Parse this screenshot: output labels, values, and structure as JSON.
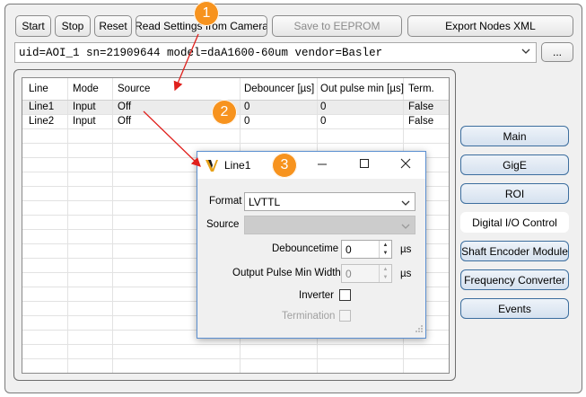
{
  "toolbar": {
    "start": "Start",
    "stop": "Stop",
    "reset": "Reset",
    "read_settings": "Read Settings from Camera",
    "save_eeprom": "Save to EEPROM",
    "export_nodes": "Export Nodes XML"
  },
  "device_select": {
    "value": "uid=AOI_1 sn=21909644 model=daA1600-60um vendor=Basler",
    "browse_label": "..."
  },
  "grid": {
    "columns": [
      "Line",
      "Mode",
      "Source",
      "Debouncer [µs]",
      "Out pulse min [µs]",
      "Term."
    ],
    "rows": [
      [
        "Line1",
        "Input",
        "Off",
        "0",
        "0",
        "False"
      ],
      [
        "Line2",
        "Input",
        "Off",
        "0",
        "0",
        "False"
      ]
    ]
  },
  "side_nav": [
    {
      "label": "Main"
    },
    {
      "label": "GigE"
    },
    {
      "label": "ROI"
    },
    {
      "label": "Digital I/O Control"
    },
    {
      "label": "Shaft Encoder Module"
    },
    {
      "label": "Frequency Converter"
    },
    {
      "label": "Events"
    }
  ],
  "dialog": {
    "title": "Line1",
    "format_label": "Format",
    "format_value": "LVTTL",
    "source_label": "Source",
    "source_value": "",
    "debounce_label": "Debouncetime",
    "debounce_value": "0",
    "debounce_unit": "µs",
    "pulse_label": "Output Pulse Min Width",
    "pulse_value": "0",
    "pulse_unit": "µs",
    "inverter_label": "Inverter",
    "termination_label": "Termination"
  },
  "markers": [
    "1",
    "2",
    "3"
  ],
  "colors": {
    "marker": "#f7931e",
    "arrow": "#e0201c",
    "nav_border": "#3c6e9e"
  }
}
